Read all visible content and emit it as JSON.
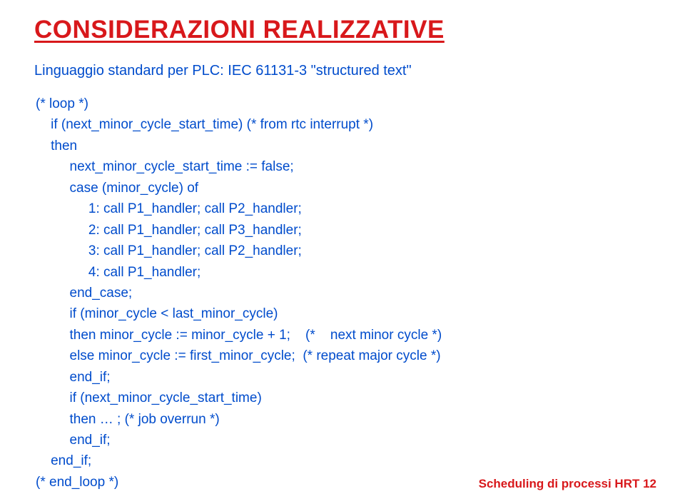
{
  "title": "CONSIDERAZIONI REALIZZATIVE",
  "subtitle": "Linguaggio standard per PLC: IEC 61131-3 \"structured text\"",
  "code": {
    "l1": "(* loop *)",
    "l2": "    if (next_minor_cycle_start_time) (* from rtc interrupt *)",
    "l3": "    then",
    "l4": "         next_minor_cycle_start_time := false;",
    "l5": "         case (minor_cycle) of",
    "l6": "              1: call P1_handler; call P2_handler;",
    "l7": "              2: call P1_handler; call P3_handler;",
    "l8": "              3: call P1_handler; call P2_handler;",
    "l9": "              4: call P1_handler;",
    "l10": "         end_case;",
    "l11": "         if (minor_cycle < last_minor_cycle)",
    "l12": "         then minor_cycle := minor_cycle + 1;    (*    next minor cycle *)",
    "l13": "         else minor_cycle := first_minor_cycle;  (* repeat major cycle *)",
    "l14": "         end_if;",
    "l15": "         if (next_minor_cycle_start_time)",
    "l16": "         then … ; (* job overrun *)",
    "l17": "         end_if;",
    "l18": "    end_if;",
    "l19": "(* end_loop *)"
  },
  "footer": "Scheduling di processi HRT   12"
}
